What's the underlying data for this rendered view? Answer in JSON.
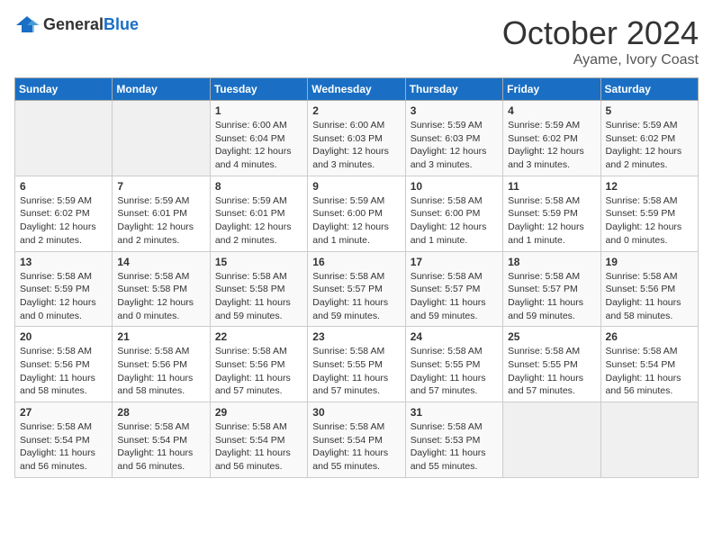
{
  "header": {
    "logo": {
      "general": "General",
      "blue": "Blue"
    },
    "title": "October 2024",
    "location": "Ayame, Ivory Coast"
  },
  "days_of_week": [
    "Sunday",
    "Monday",
    "Tuesday",
    "Wednesday",
    "Thursday",
    "Friday",
    "Saturday"
  ],
  "weeks": [
    [
      {
        "day": null
      },
      {
        "day": null
      },
      {
        "day": 1,
        "sunrise": "Sunrise: 6:00 AM",
        "sunset": "Sunset: 6:04 PM",
        "daylight": "Daylight: 12 hours and 4 minutes."
      },
      {
        "day": 2,
        "sunrise": "Sunrise: 6:00 AM",
        "sunset": "Sunset: 6:03 PM",
        "daylight": "Daylight: 12 hours and 3 minutes."
      },
      {
        "day": 3,
        "sunrise": "Sunrise: 5:59 AM",
        "sunset": "Sunset: 6:03 PM",
        "daylight": "Daylight: 12 hours and 3 minutes."
      },
      {
        "day": 4,
        "sunrise": "Sunrise: 5:59 AM",
        "sunset": "Sunset: 6:02 PM",
        "daylight": "Daylight: 12 hours and 3 minutes."
      },
      {
        "day": 5,
        "sunrise": "Sunrise: 5:59 AM",
        "sunset": "Sunset: 6:02 PM",
        "daylight": "Daylight: 12 hours and 2 minutes."
      }
    ],
    [
      {
        "day": 6,
        "sunrise": "Sunrise: 5:59 AM",
        "sunset": "Sunset: 6:02 PM",
        "daylight": "Daylight: 12 hours and 2 minutes."
      },
      {
        "day": 7,
        "sunrise": "Sunrise: 5:59 AM",
        "sunset": "Sunset: 6:01 PM",
        "daylight": "Daylight: 12 hours and 2 minutes."
      },
      {
        "day": 8,
        "sunrise": "Sunrise: 5:59 AM",
        "sunset": "Sunset: 6:01 PM",
        "daylight": "Daylight: 12 hours and 2 minutes."
      },
      {
        "day": 9,
        "sunrise": "Sunrise: 5:59 AM",
        "sunset": "Sunset: 6:00 PM",
        "daylight": "Daylight: 12 hours and 1 minute."
      },
      {
        "day": 10,
        "sunrise": "Sunrise: 5:58 AM",
        "sunset": "Sunset: 6:00 PM",
        "daylight": "Daylight: 12 hours and 1 minute."
      },
      {
        "day": 11,
        "sunrise": "Sunrise: 5:58 AM",
        "sunset": "Sunset: 5:59 PM",
        "daylight": "Daylight: 12 hours and 1 minute."
      },
      {
        "day": 12,
        "sunrise": "Sunrise: 5:58 AM",
        "sunset": "Sunset: 5:59 PM",
        "daylight": "Daylight: 12 hours and 0 minutes."
      }
    ],
    [
      {
        "day": 13,
        "sunrise": "Sunrise: 5:58 AM",
        "sunset": "Sunset: 5:59 PM",
        "daylight": "Daylight: 12 hours and 0 minutes."
      },
      {
        "day": 14,
        "sunrise": "Sunrise: 5:58 AM",
        "sunset": "Sunset: 5:58 PM",
        "daylight": "Daylight: 12 hours and 0 minutes."
      },
      {
        "day": 15,
        "sunrise": "Sunrise: 5:58 AM",
        "sunset": "Sunset: 5:58 PM",
        "daylight": "Daylight: 11 hours and 59 minutes."
      },
      {
        "day": 16,
        "sunrise": "Sunrise: 5:58 AM",
        "sunset": "Sunset: 5:57 PM",
        "daylight": "Daylight: 11 hours and 59 minutes."
      },
      {
        "day": 17,
        "sunrise": "Sunrise: 5:58 AM",
        "sunset": "Sunset: 5:57 PM",
        "daylight": "Daylight: 11 hours and 59 minutes."
      },
      {
        "day": 18,
        "sunrise": "Sunrise: 5:58 AM",
        "sunset": "Sunset: 5:57 PM",
        "daylight": "Daylight: 11 hours and 59 minutes."
      },
      {
        "day": 19,
        "sunrise": "Sunrise: 5:58 AM",
        "sunset": "Sunset: 5:56 PM",
        "daylight": "Daylight: 11 hours and 58 minutes."
      }
    ],
    [
      {
        "day": 20,
        "sunrise": "Sunrise: 5:58 AM",
        "sunset": "Sunset: 5:56 PM",
        "daylight": "Daylight: 11 hours and 58 minutes."
      },
      {
        "day": 21,
        "sunrise": "Sunrise: 5:58 AM",
        "sunset": "Sunset: 5:56 PM",
        "daylight": "Daylight: 11 hours and 58 minutes."
      },
      {
        "day": 22,
        "sunrise": "Sunrise: 5:58 AM",
        "sunset": "Sunset: 5:56 PM",
        "daylight": "Daylight: 11 hours and 57 minutes."
      },
      {
        "day": 23,
        "sunrise": "Sunrise: 5:58 AM",
        "sunset": "Sunset: 5:55 PM",
        "daylight": "Daylight: 11 hours and 57 minutes."
      },
      {
        "day": 24,
        "sunrise": "Sunrise: 5:58 AM",
        "sunset": "Sunset: 5:55 PM",
        "daylight": "Daylight: 11 hours and 57 minutes."
      },
      {
        "day": 25,
        "sunrise": "Sunrise: 5:58 AM",
        "sunset": "Sunset: 5:55 PM",
        "daylight": "Daylight: 11 hours and 57 minutes."
      },
      {
        "day": 26,
        "sunrise": "Sunrise: 5:58 AM",
        "sunset": "Sunset: 5:54 PM",
        "daylight": "Daylight: 11 hours and 56 minutes."
      }
    ],
    [
      {
        "day": 27,
        "sunrise": "Sunrise: 5:58 AM",
        "sunset": "Sunset: 5:54 PM",
        "daylight": "Daylight: 11 hours and 56 minutes."
      },
      {
        "day": 28,
        "sunrise": "Sunrise: 5:58 AM",
        "sunset": "Sunset: 5:54 PM",
        "daylight": "Daylight: 11 hours and 56 minutes."
      },
      {
        "day": 29,
        "sunrise": "Sunrise: 5:58 AM",
        "sunset": "Sunset: 5:54 PM",
        "daylight": "Daylight: 11 hours and 56 minutes."
      },
      {
        "day": 30,
        "sunrise": "Sunrise: 5:58 AM",
        "sunset": "Sunset: 5:54 PM",
        "daylight": "Daylight: 11 hours and 55 minutes."
      },
      {
        "day": 31,
        "sunrise": "Sunrise: 5:58 AM",
        "sunset": "Sunset: 5:53 PM",
        "daylight": "Daylight: 11 hours and 55 minutes."
      },
      {
        "day": null
      },
      {
        "day": null
      }
    ]
  ]
}
